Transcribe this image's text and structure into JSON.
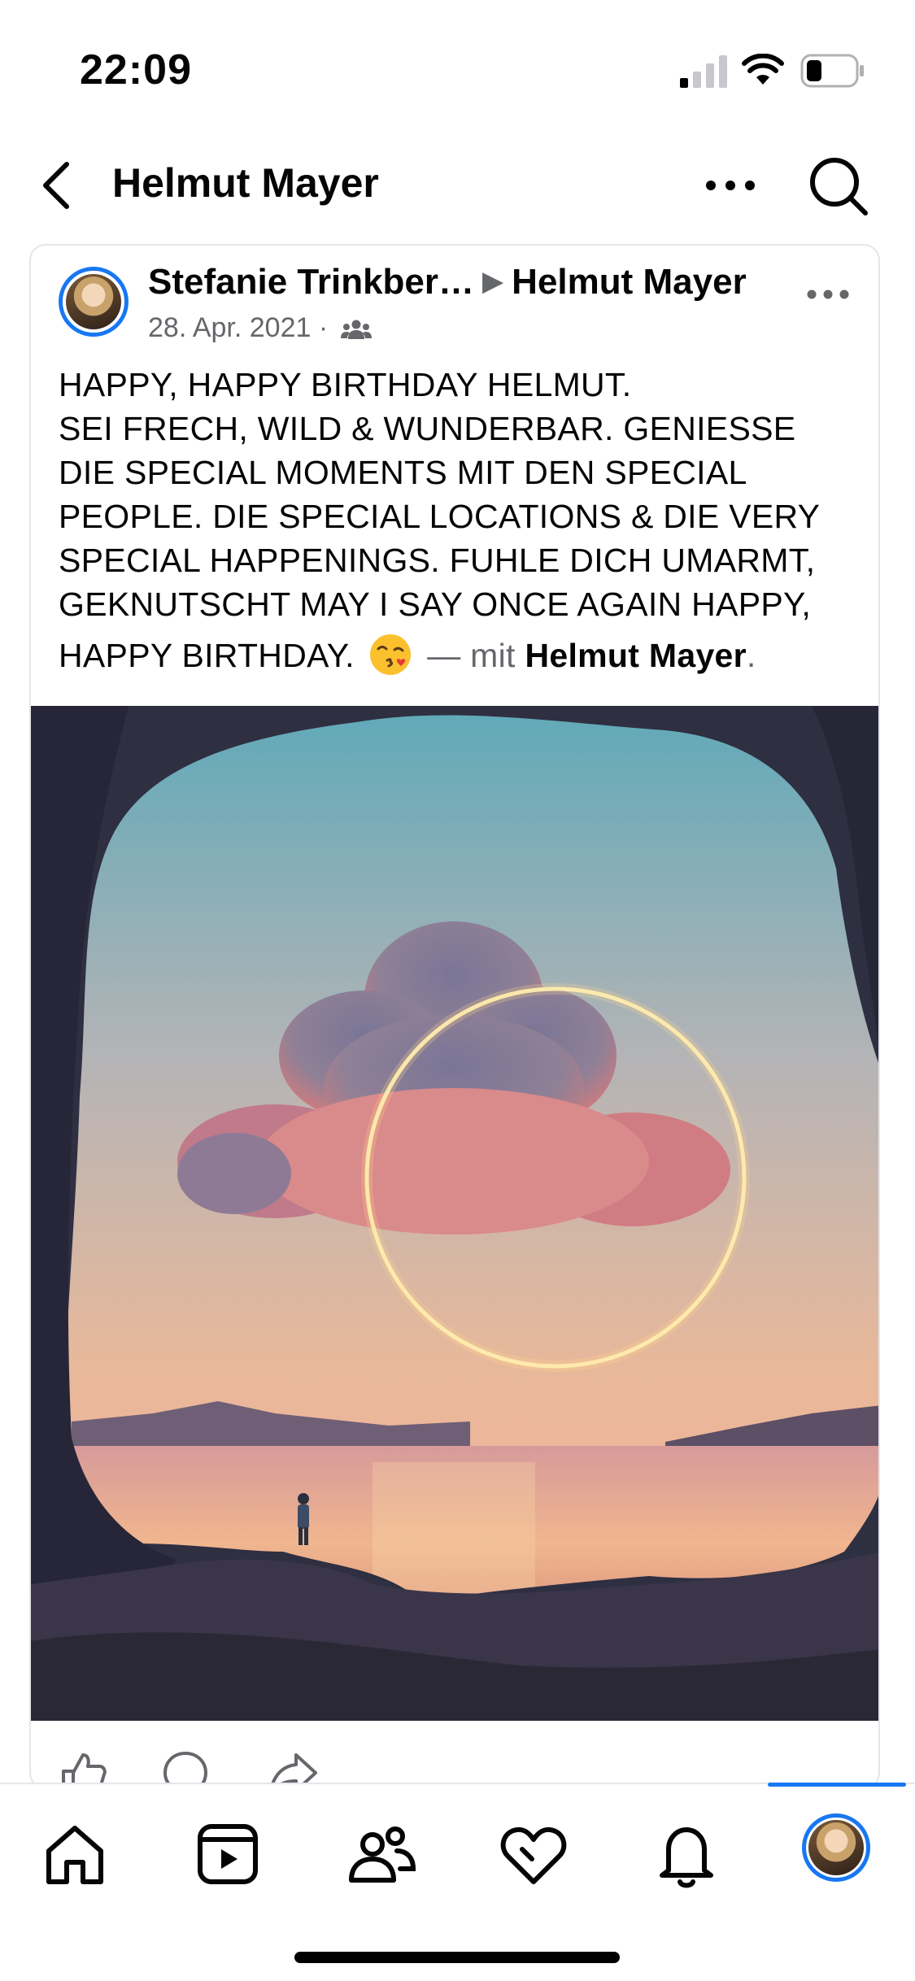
{
  "status_bar": {
    "time": "22:09",
    "icons": [
      "cellular-signal-icon",
      "wifi-icon",
      "battery-icon"
    ]
  },
  "header": {
    "title": "Helmut Mayer",
    "back_icon": "chevron-left-icon",
    "more_icon": "more-horizontal-icon",
    "search_icon": "search-icon"
  },
  "post": {
    "author": "Stefanie Trinkber…",
    "recipient": "Helmut Mayer",
    "arrow": "▶",
    "date": "28. Apr. 2021",
    "separator": "·",
    "audience_icon": "friends-icon",
    "text_lines": [
      "HAPPY, HAPPY BIRTHDAY HELMUT.",
      "SEI FRECH, WILD & WUNDERBAR. GENIESSE",
      "DIE SPECIAL MOMENTS MIT DEN SPECIAL",
      "PEOPLE. DIE SPECIAL LOCATIONS & DIE VERY",
      "SPECIAL HAPPENINGS. FUHLE DICH UMARMT,",
      "GEKNUTSCHT MAY I SAY ONCE AGAIN HAPPY,"
    ],
    "last_line_text": "HAPPY BIRTHDAY.",
    "emoji": "face-blowing-a-kiss",
    "tag_prefix": "— mit",
    "tagged_name": "Helmut Mayer",
    "tag_suffix": ".",
    "image_icon": "cave-sunset-cloud-ring-photo",
    "actions": [
      "like-icon",
      "comment-icon",
      "share-icon"
    ]
  },
  "tab_bar": {
    "tabs": [
      "home-icon",
      "video-icon",
      "friends-icon",
      "dating-heart-icon",
      "notifications-icon",
      "profile-avatar"
    ],
    "active_tab": "profile-avatar"
  },
  "colors": {
    "accent": "#1877f2",
    "text_primary": "#050505",
    "text_secondary": "#65676b",
    "divider": "#e4e6eb"
  }
}
